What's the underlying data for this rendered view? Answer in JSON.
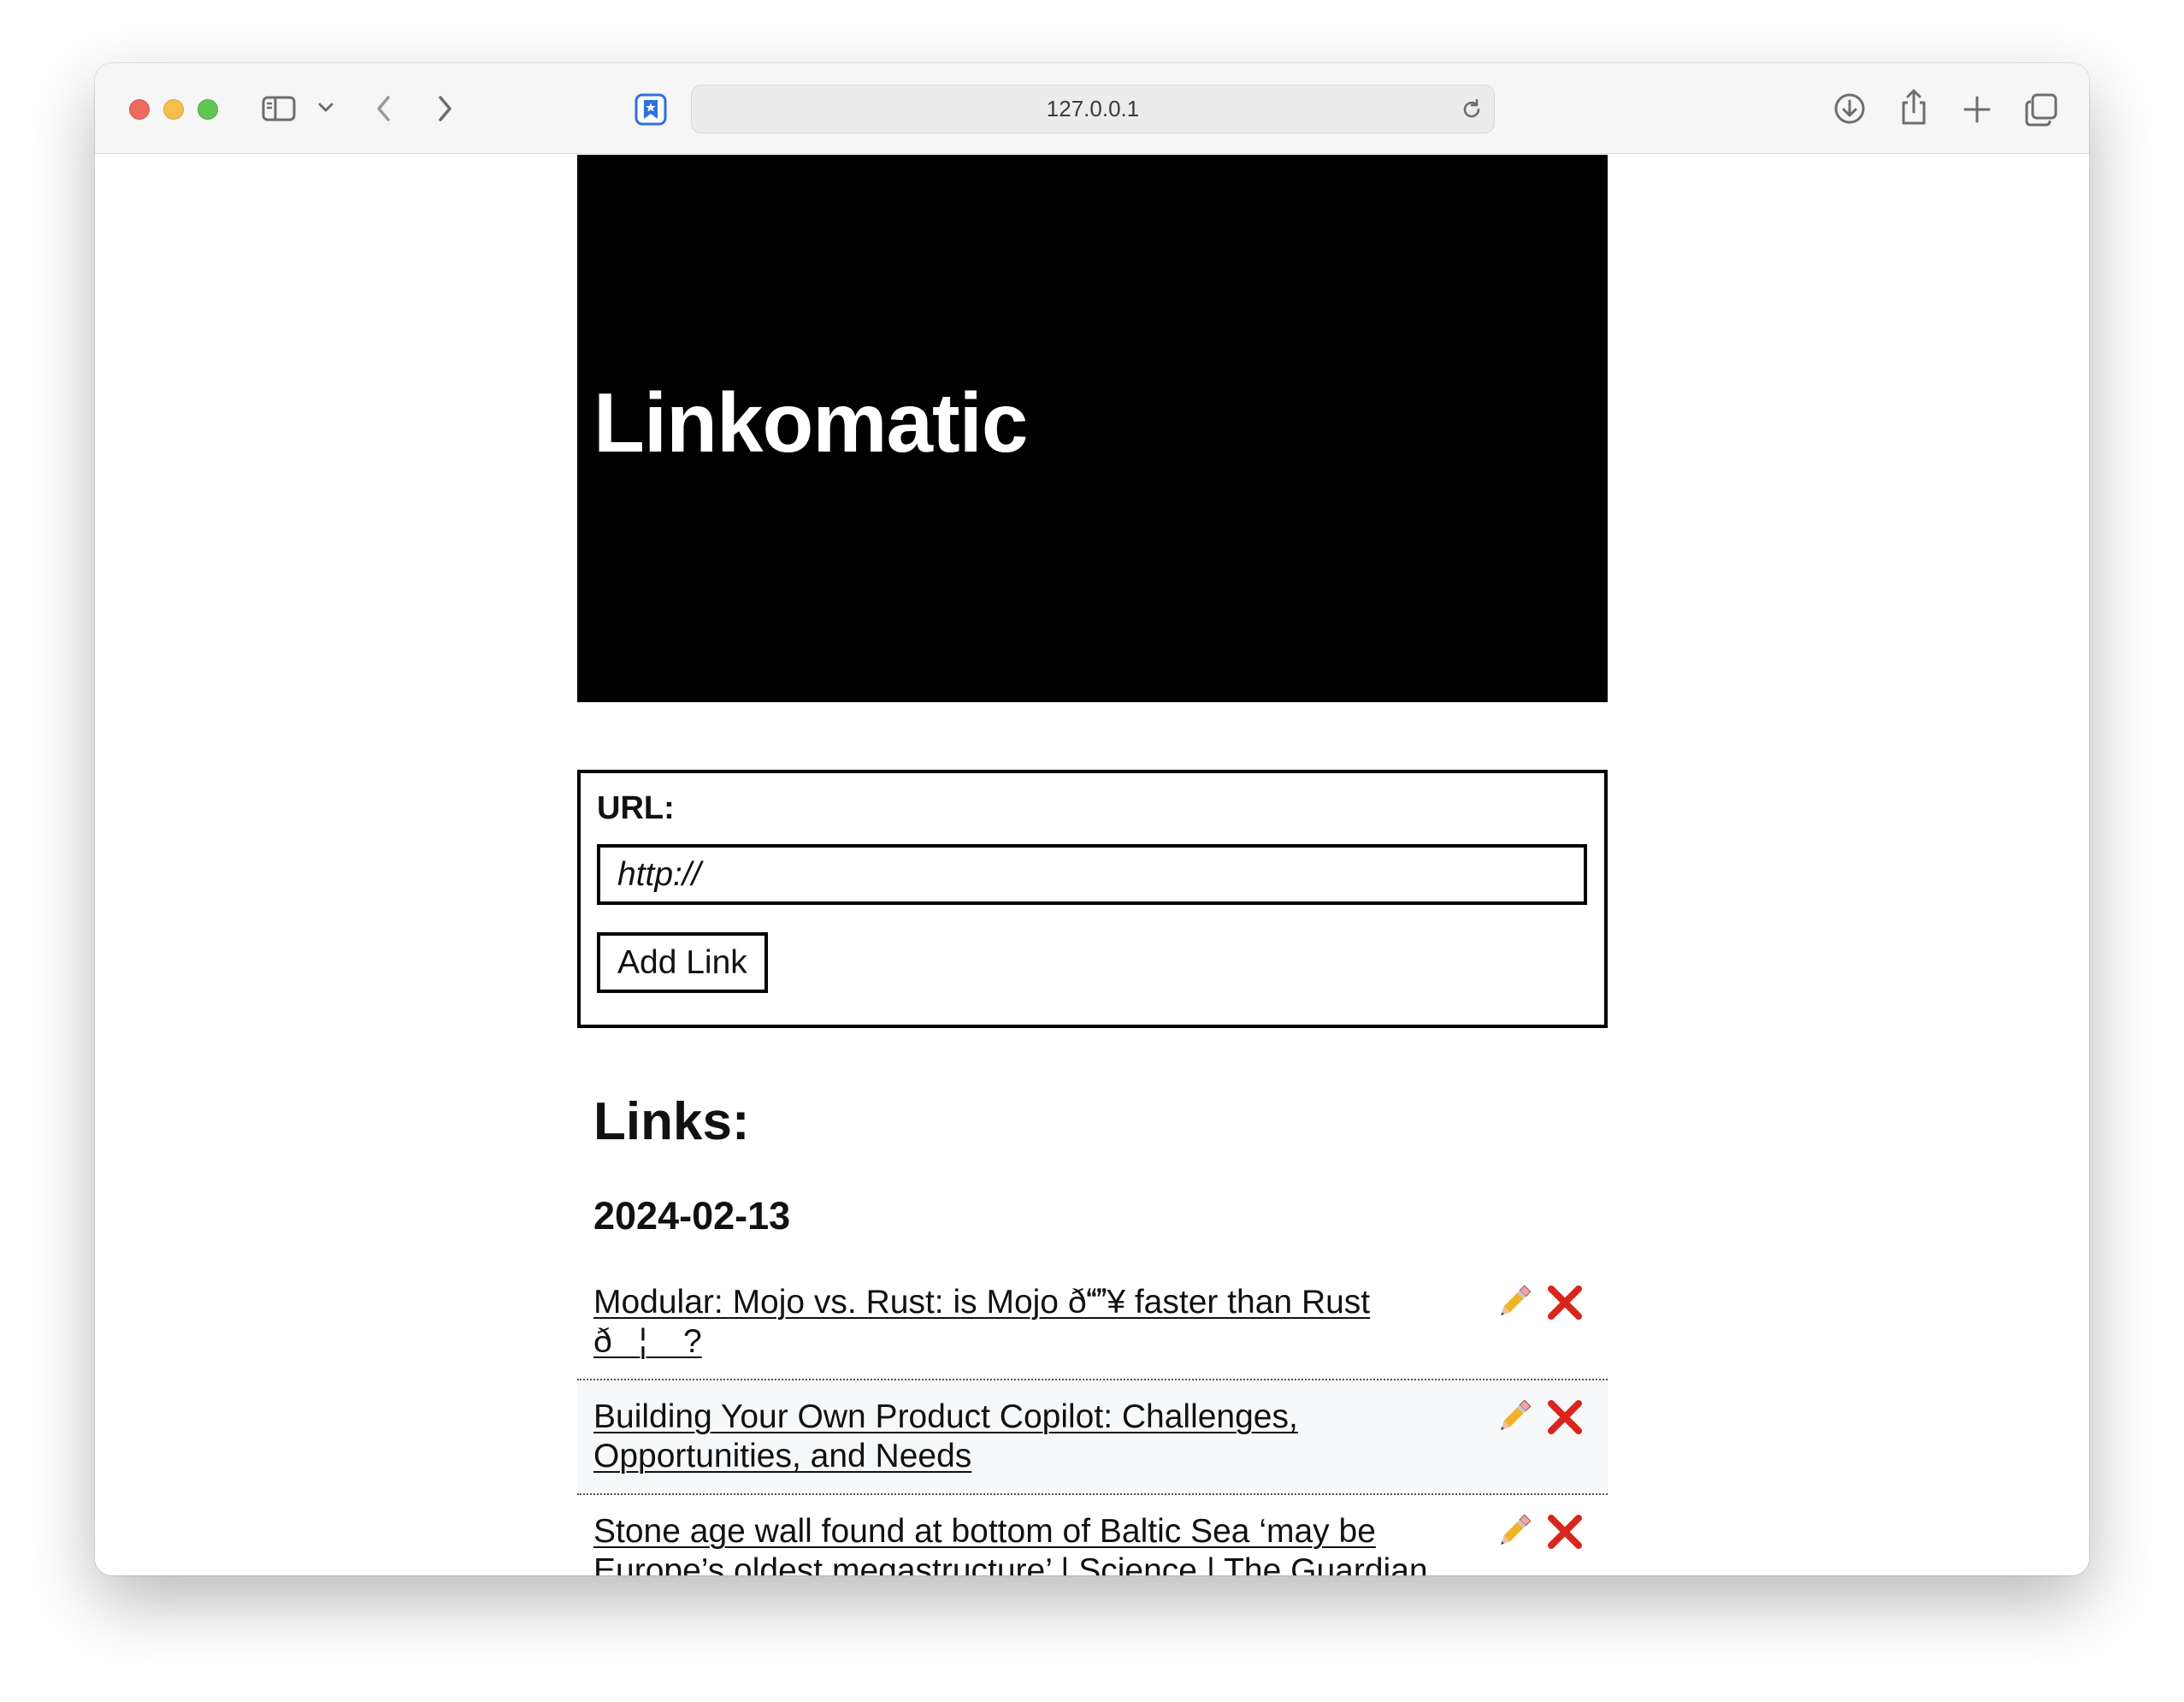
{
  "browser": {
    "address": "127.0.0.1",
    "icons": {
      "sidebar": "sidebar-icon",
      "sidebar_menu": "chevron-down-icon",
      "back": "chevron-left-icon",
      "forward": "chevron-right-icon",
      "tab_favicon": "bookmark-star-icon",
      "reload": "reload-icon",
      "downloads": "download-icon",
      "share": "share-icon",
      "new_tab": "plus-icon",
      "tabs_overview": "tabs-icon"
    }
  },
  "header": {
    "title": "Linkomatic"
  },
  "form": {
    "url_label": "URL:",
    "url_placeholder": "http://",
    "url_value": "",
    "add_button_label": "Add Link"
  },
  "links": {
    "heading": "Links:",
    "groups": [
      {
        "date": "2024-02-13",
        "items": [
          {
            "title": "Modular: Mojo vs. Rust: is Mojo ð¥ faster than Rust ð¦ ?",
            "edit_icon": "pencil-icon",
            "delete_icon": "red-x-icon"
          },
          {
            "title": "Building Your Own Product Copilot: Challenges, Opportunities, and Needs",
            "edit_icon": "pencil-icon",
            "delete_icon": "red-x-icon"
          },
          {
            "title": "Stone age wall found at bottom of Baltic Sea ‘may be Europe’s oldest megastructure’ | Science | The Guardian",
            "edit_icon": "pencil-icon",
            "delete_icon": "red-x-icon"
          }
        ]
      }
    ]
  },
  "colors": {
    "hero_background": "#000000",
    "hero_text": "#ffffff",
    "delete": "#d9261c",
    "alt_row": "#f6f8fa"
  }
}
